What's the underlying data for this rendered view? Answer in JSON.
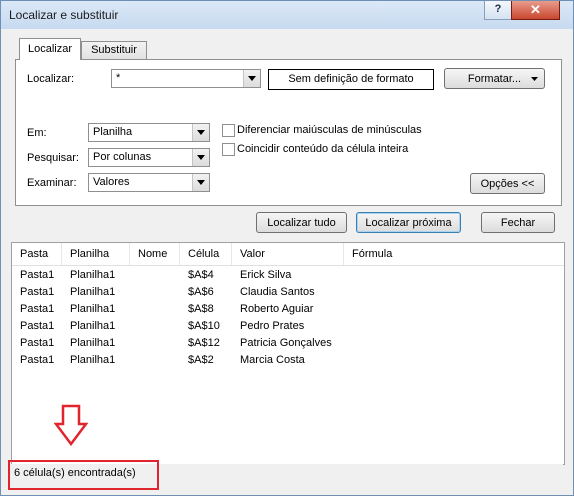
{
  "window": {
    "title": "Localizar e substituir",
    "help_label": "?",
    "close_label": "✕"
  },
  "tabs": [
    {
      "label": "Localizar",
      "active": true
    },
    {
      "label": "Substituir",
      "active": false
    }
  ],
  "find": {
    "label": "Localizar:",
    "value": "*",
    "format_preview": "Sem definição de formato",
    "format_button": "Formatar..."
  },
  "options": {
    "within_label": "Em:",
    "within_value": "Planilha",
    "search_label": "Pesquisar:",
    "search_value": "Por colunas",
    "look_in_label": "Examinar:",
    "look_in_value": "Valores",
    "match_case_label": "Diferenciar maiúsculas de minúsculas",
    "match_case_checked": false,
    "entire_cell_label": "Coincidir conteúdo da célula inteira",
    "entire_cell_checked": false,
    "options_button": "Opções <<"
  },
  "actions": {
    "find_all": "Localizar tudo",
    "find_next": "Localizar próxima",
    "close": "Fechar"
  },
  "results": {
    "columns": [
      "Pasta",
      "Planilha",
      "Nome",
      "Célula",
      "Valor",
      "Fórmula"
    ],
    "rows": [
      [
        "Pasta1",
        "Planilha1",
        "",
        "$A$4",
        "Erick Silva",
        ""
      ],
      [
        "Pasta1",
        "Planilha1",
        "",
        "$A$6",
        "Claudia Santos",
        ""
      ],
      [
        "Pasta1",
        "Planilha1",
        "",
        "$A$8",
        "Roberto Aguiar",
        ""
      ],
      [
        "Pasta1",
        "Planilha1",
        "",
        "$A$10",
        "Pedro Prates",
        ""
      ],
      [
        "Pasta1",
        "Planilha1",
        "",
        "$A$12",
        "Patricia Gonçalves",
        ""
      ],
      [
        "Pasta1",
        "Planilha1",
        "",
        "$A$2",
        "Marcia Costa",
        ""
      ]
    ]
  },
  "status": {
    "text": "6 célula(s) encontrada(s)"
  },
  "annotation": {
    "color": "#e0252f"
  }
}
